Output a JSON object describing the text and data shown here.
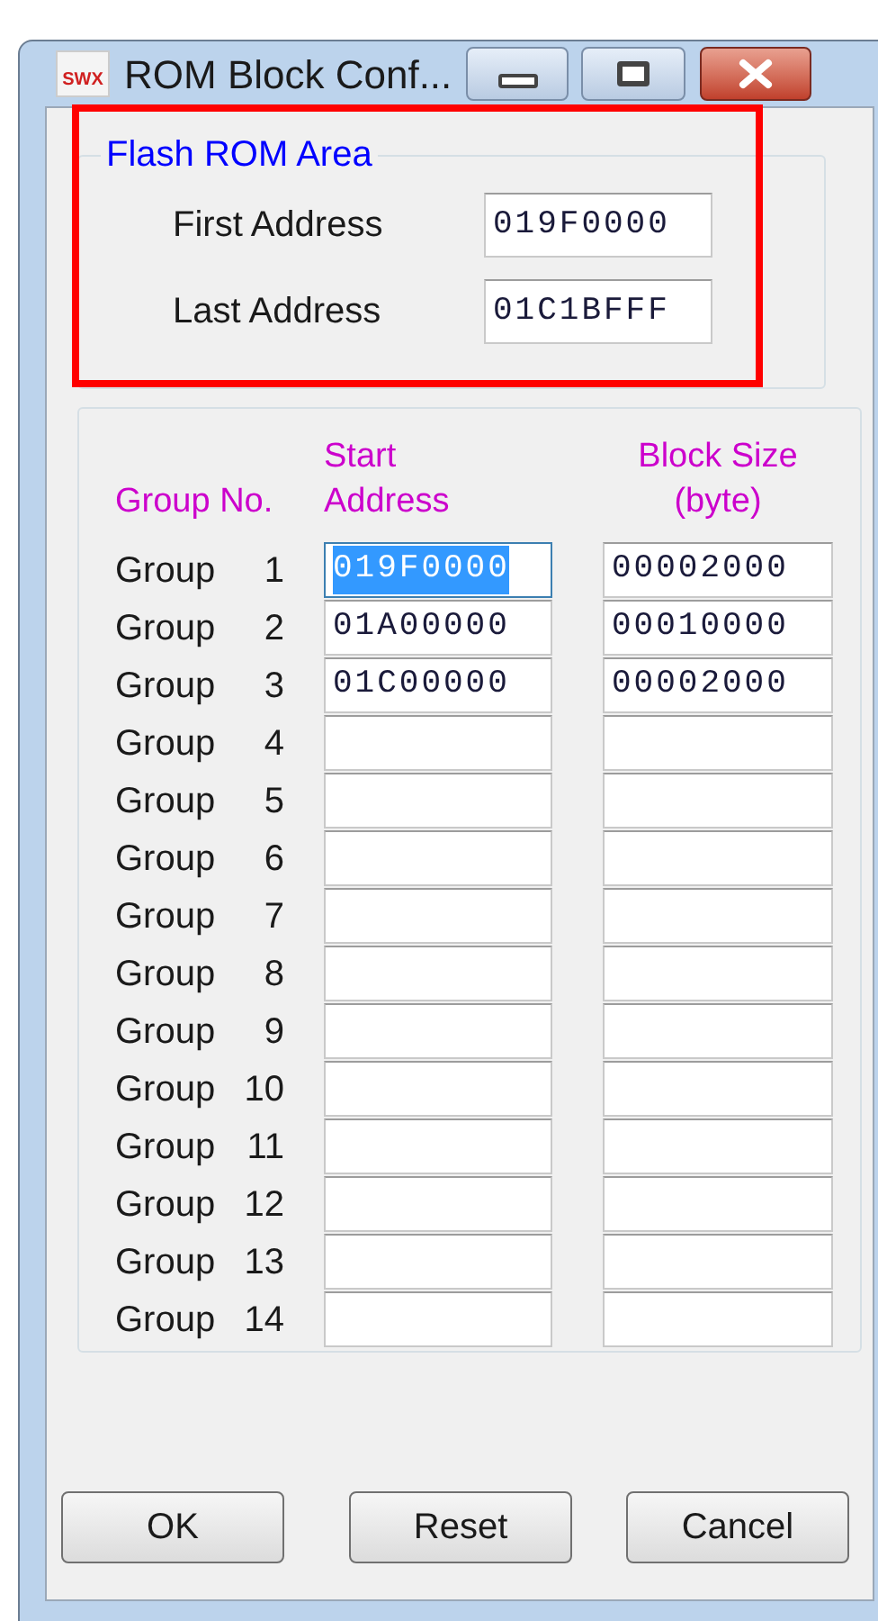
{
  "window": {
    "icon_text": "SWX",
    "title": "ROM Block Conf..."
  },
  "flash_rom_area": {
    "title": "Flash ROM Area",
    "fields": [
      {
        "label": "First Address",
        "value": "019F0000"
      },
      {
        "label": "Last Address",
        "value": "01C1BFFF"
      }
    ]
  },
  "groups": {
    "columns": [
      "Group No.",
      "Start\nAddress",
      "Block Size\n(byte)"
    ],
    "rows": [
      {
        "label": "Group",
        "number": "1",
        "start_address": "019F0000",
        "block_size": "00002000",
        "start_selected": true
      },
      {
        "label": "Group",
        "number": "2",
        "start_address": "01A00000",
        "block_size": "00010000",
        "start_selected": false
      },
      {
        "label": "Group",
        "number": "3",
        "start_address": "01C00000",
        "block_size": "00002000",
        "start_selected": false
      },
      {
        "label": "Group",
        "number": "4",
        "start_selected": false
      },
      {
        "label": "Group",
        "number": "5",
        "start_selected": false
      },
      {
        "label": "Group",
        "number": "6",
        "start_selected": false
      },
      {
        "label": "Group",
        "number": "7",
        "start_selected": false
      },
      {
        "label": "Group",
        "number": "8",
        "start_selected": false
      },
      {
        "label": "Group",
        "number": "9",
        "start_selected": false
      },
      {
        "label": "Group",
        "number": "10",
        "start_selected": false
      },
      {
        "label": "Group",
        "number": "11",
        "start_selected": false
      },
      {
        "label": "Group",
        "number": "12",
        "start_selected": false
      },
      {
        "label": "Group",
        "number": "13",
        "start_selected": false
      },
      {
        "label": "Group",
        "number": "14",
        "start_selected": false
      }
    ]
  },
  "buttons": [
    "OK",
    "Reset",
    "Cancel"
  ]
}
